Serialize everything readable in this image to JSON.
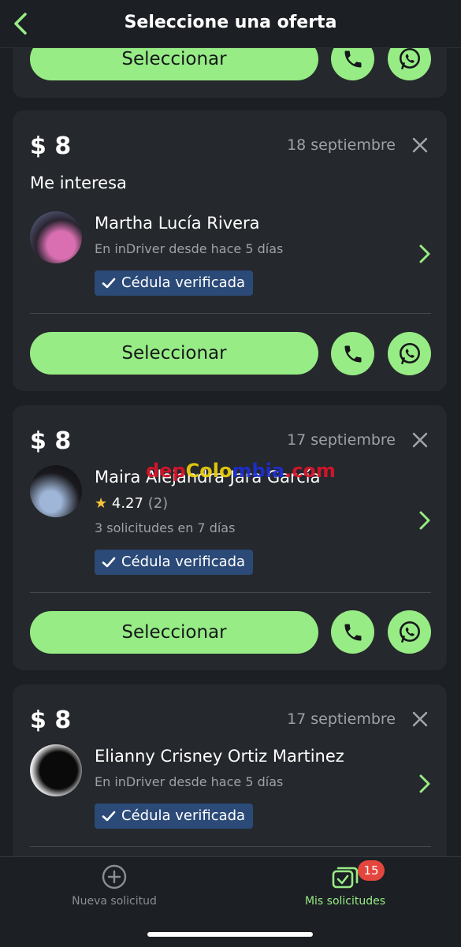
{
  "header": {
    "title": "Seleccione una oferta"
  },
  "offers": [
    {
      "price": "$ 8",
      "date": "18 septiembre",
      "message": "Me interesa",
      "name": "Martha Lucía Rivera",
      "subtitle": "En inDriver desde hace 5 días",
      "badge": "Cédula verificada",
      "select_label": "Seleccionar"
    },
    {
      "price": "$ 8",
      "date": "17 septiembre",
      "name": "Maira Alejandra Jara García",
      "rating": "4.27",
      "rating_count": "(2)",
      "subtitle": "3 solicitudes en 7 días",
      "badge": "Cédula verificada",
      "select_label": "Seleccionar"
    },
    {
      "price": "$ 8",
      "date": "17 septiembre",
      "name": "Elianny Crisney Ortiz Martinez",
      "subtitle": "En inDriver desde hace 5 días",
      "badge": "Cédula verificada"
    }
  ],
  "top_card": {
    "select_label": "Seleccionar"
  },
  "watermark": {
    "part1": "dep",
    "part2": "Colo",
    "part3": "mbia",
    "part4": ".com"
  },
  "tabbar": {
    "new_request": "Nueva solicitud",
    "my_requests": "Mis solicitudes",
    "my_requests_badge": "15"
  },
  "colors": {
    "accent": "#97ec85",
    "badge_bg": "#2b4a78",
    "notification": "#e4463e"
  }
}
